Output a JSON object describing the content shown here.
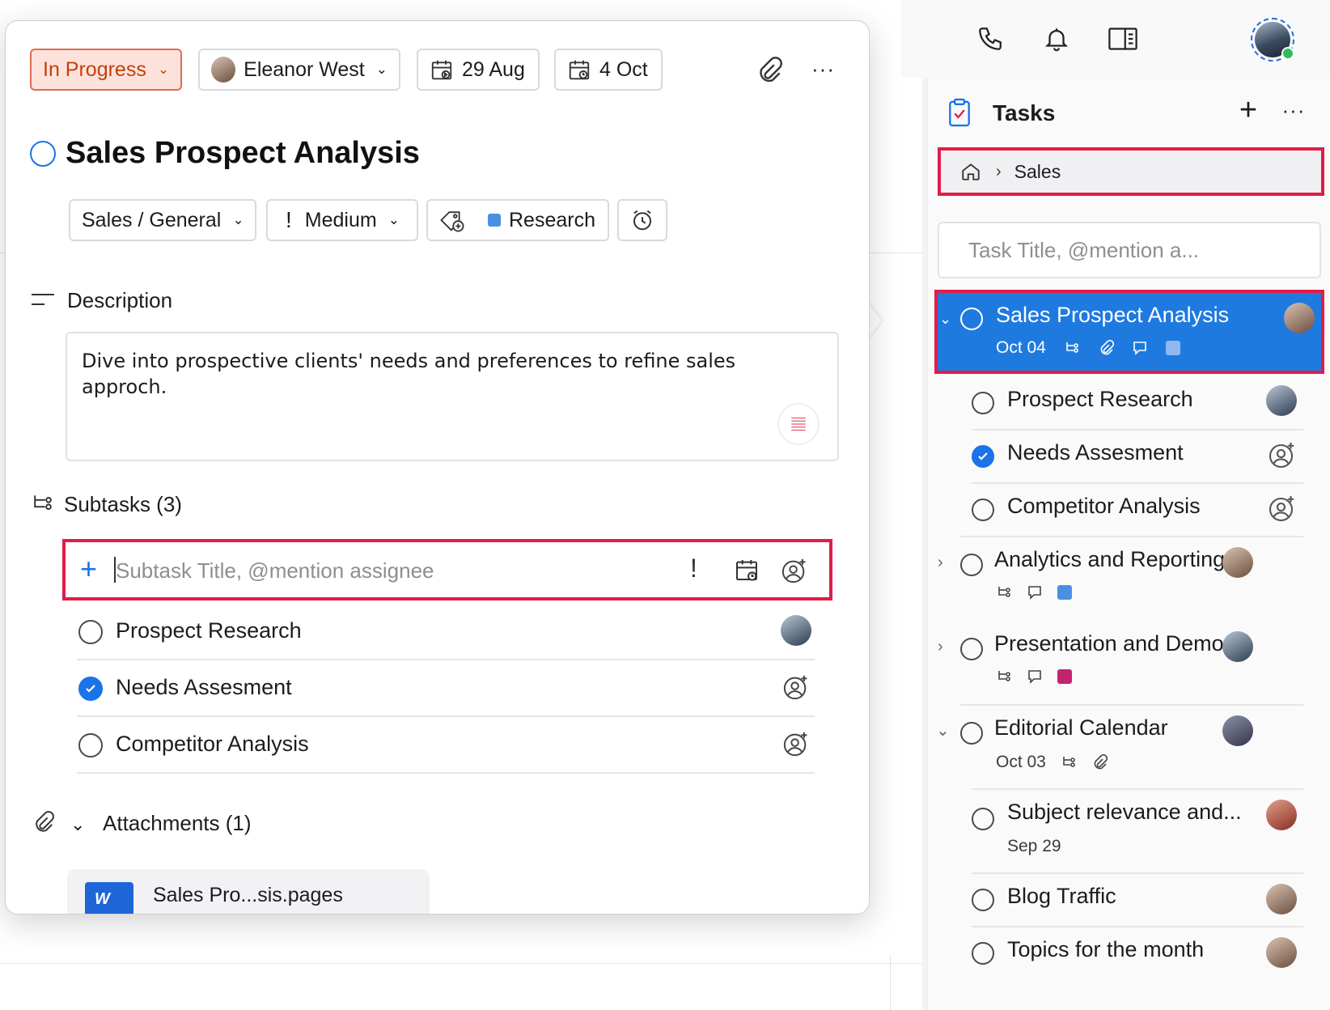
{
  "header": {
    "icons": [
      "phone-icon",
      "bell-icon",
      "sidebar-toggle-icon",
      "profile-avatar"
    ]
  },
  "task": {
    "status": "In Progress",
    "assignee": "Eleanor West",
    "start_date": "29 Aug",
    "due_date": "4 Oct",
    "title": "Sales Prospect Analysis",
    "list": "Sales / General",
    "priority": "Medium",
    "tag": "Research",
    "tag_color": "#4a90e2",
    "description_label": "Description",
    "description": "Dive into prospective clients' needs and preferences to refine sales approch.",
    "subtasks_label": "Subtasks (3)",
    "subtask_placeholder": "Subtask Title, @mention assignee",
    "subtasks": [
      {
        "title": "Prospect Research",
        "done": false,
        "assigned": true
      },
      {
        "title": "Needs Assesment",
        "done": true,
        "assigned": false
      },
      {
        "title": "Competitor Analysis",
        "done": false,
        "assigned": false
      }
    ],
    "attachments_label": "Attachments (1)",
    "attachment_name": "Sales Pro...sis.pages",
    "attachment_badge": "W"
  },
  "tasks_panel": {
    "title": "Tasks",
    "breadcrumb": "Sales",
    "search_placeholder": "Task Title, @mention a...",
    "items": [
      {
        "title": "Sales Prospect Analysis",
        "date": "Oct 04",
        "selected": true,
        "tag_color": "#8fb8f0"
      },
      {
        "title": "Prospect Research"
      },
      {
        "title": "Needs Assesment",
        "done": true
      },
      {
        "title": "Competitor Analysis"
      },
      {
        "title": "Analytics and Reporting",
        "tag_color": "#4a90e2"
      },
      {
        "title": "Presentation and Demos",
        "tag_color": "#c2256e"
      },
      {
        "title": "Editorial Calendar",
        "date": "Oct 03"
      },
      {
        "title": "Subject relevance and...",
        "date": "Sep 29"
      },
      {
        "title": "Blog Traffic"
      },
      {
        "title": "Topics for the month"
      }
    ]
  },
  "colors": {
    "accent": "#1a73e8",
    "highlight": "#e11d48",
    "status_bg": "#fde2dc",
    "status_text": "#c2410c",
    "selected_row": "#1f7ae0"
  }
}
